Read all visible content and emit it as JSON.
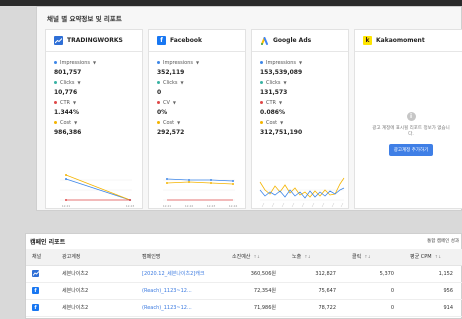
{
  "summary": {
    "title": "채널 별 요약정보 및 리포트",
    "channels": [
      {
        "name": "TRADINGWORKS",
        "logo_icon": "trendline-icon",
        "metrics": [
          {
            "label": "Impressions",
            "value": "801,757",
            "color": "#3d86e8"
          },
          {
            "label": "Clicks",
            "value": "10,776",
            "color": "#38b2a3"
          },
          {
            "label": "CTR",
            "value": "1.344%",
            "color": "#e04848"
          },
          {
            "label": "Cost",
            "value": "986,386",
            "color": "#f4b400"
          }
        ],
        "chart_ticks": [
          "12.21",
          "12.23"
        ]
      },
      {
        "name": "Facebook",
        "logo_icon": "facebook-icon",
        "metrics": [
          {
            "label": "Impressions",
            "value": "352,119",
            "color": "#3d86e8"
          },
          {
            "label": "Clicks",
            "value": "0",
            "color": "#38b2a3"
          },
          {
            "label": "CV",
            "value": "0%",
            "color": "#e04848"
          },
          {
            "label": "Cost",
            "value": "292,572",
            "color": "#f4b400"
          }
        ],
        "chart_ticks": [
          "12.21",
          "12.22",
          "12.23",
          "12.24"
        ]
      },
      {
        "name": "Google Ads",
        "logo_icon": "google-ads-icon",
        "metrics": [
          {
            "label": "Impressions",
            "value": "153,539,089",
            "color": "#3d86e8"
          },
          {
            "label": "Clicks",
            "value": "131,573",
            "color": "#38b2a3"
          },
          {
            "label": "CTR",
            "value": "0.086%",
            "color": "#e04848"
          },
          {
            "label": "Cost",
            "value": "312,751,190",
            "color": "#f4b400"
          }
        ]
      },
      {
        "name": "Kakaomoment",
        "logo_icon": "kakao-icon",
        "empty_message": "광고 계정에 표시될 리포트 정보가 없습니다.",
        "add_button": "광고계정 추가하기"
      }
    ]
  },
  "campaign": {
    "title": "캠페인 리포트",
    "right_label": "통합 캠페인 성과",
    "columns": [
      "채널",
      "광고계정",
      "캠페인명",
      "소진예산",
      "노출",
      "클릭",
      "평균 CPM"
    ],
    "rows": [
      {
        "channel": "tradingworks",
        "account": "세븐나이츠2",
        "campaign": "[2020.12_세븐나이츠2]캐크",
        "spend": "360,506원",
        "impressions": "312,827",
        "clicks": "5,370",
        "cpm": "1,152"
      },
      {
        "channel": "facebook",
        "account": "세븐나이츠2",
        "campaign": "(Reach)_1123~12...",
        "spend": "72,354원",
        "impressions": "75,647",
        "clicks": "0",
        "cpm": "956"
      },
      {
        "channel": "facebook",
        "account": "세븐나이츠2",
        "campaign": "(Reach)_1123~12...",
        "spend": "71,986원",
        "impressions": "78,722",
        "clicks": "0",
        "cpm": "914"
      }
    ]
  }
}
